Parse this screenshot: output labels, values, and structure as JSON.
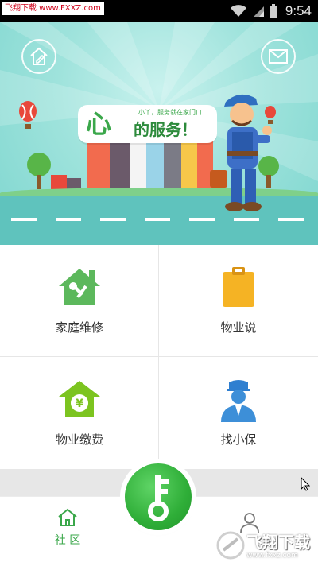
{
  "status_bar": {
    "watermark_text": "飞翔下载 www.FXXZ.com",
    "time": "9:54"
  },
  "banner": {
    "headline_big": "心",
    "headline_small": "小丫，服务就在家门口",
    "headline_main": "的服务！",
    "icons": [
      "home-edit-icon",
      "mail-icon"
    ]
  },
  "grid": {
    "items": [
      {
        "label": "家庭维修",
        "icon": "house-wrench-icon",
        "color": "#5cb85c"
      },
      {
        "label": "物业说",
        "icon": "clipboard-icon",
        "color": "#f5b324"
      },
      {
        "label": "物业缴费",
        "icon": "house-yen-icon",
        "color": "#7cc420"
      },
      {
        "label": "找小保",
        "icon": "security-guard-icon",
        "color": "#3d8fd8"
      }
    ]
  },
  "bottom_nav": {
    "community_label": "社 区",
    "center_icon": "key-icon",
    "profile_icon": "user-icon",
    "watermark_title": "飞翔下载",
    "watermark_url": "www.fxxz.com"
  }
}
